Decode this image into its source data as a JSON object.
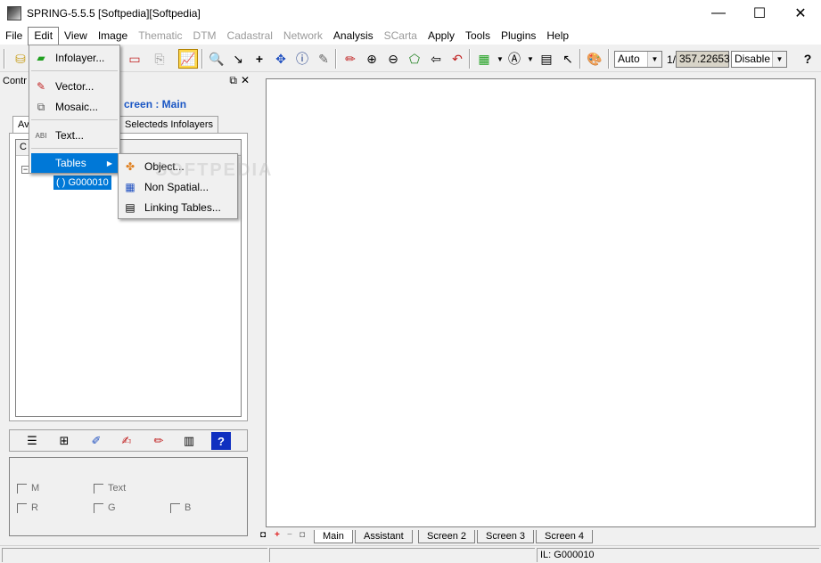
{
  "window": {
    "title": "SPRING-5.5.5 [Softpedia][Softpedia]",
    "minimize": "—",
    "maximize": "☐",
    "close": "✕"
  },
  "menubar": {
    "items": [
      {
        "label": "File",
        "enabled": true
      },
      {
        "label": "Edit",
        "enabled": true
      },
      {
        "label": "View",
        "enabled": true
      },
      {
        "label": "Image",
        "enabled": true
      },
      {
        "label": "Thematic",
        "enabled": false
      },
      {
        "label": "DTM",
        "enabled": false
      },
      {
        "label": "Cadastral",
        "enabled": false
      },
      {
        "label": "Network",
        "enabled": false
      },
      {
        "label": "Analysis",
        "enabled": true
      },
      {
        "label": "SCarta",
        "enabled": false
      },
      {
        "label": "Apply",
        "enabled": true
      },
      {
        "label": "Tools",
        "enabled": true
      },
      {
        "label": "Plugins",
        "enabled": true
      },
      {
        "label": "Help",
        "enabled": true
      }
    ]
  },
  "toolbar": {
    "auto_select": "Auto",
    "scale_prefix": "1/",
    "scale_value": "357.22653",
    "disable_select": "Disable"
  },
  "edit_menu": {
    "items": [
      {
        "label": "Infolayer...",
        "icon": "infolayer-icon"
      },
      {
        "label": "Vector...",
        "icon": "vector-icon"
      },
      {
        "label": "Mosaic...",
        "icon": "mosaic-icon"
      },
      {
        "label": "Text...",
        "icon": "text-icon"
      },
      {
        "label": "Tables",
        "icon": ""
      }
    ]
  },
  "tables_menu": {
    "items": [
      {
        "label": "Object...",
        "icon": "object-icon"
      },
      {
        "label": "Non Spatial...",
        "icon": "grid-icon"
      },
      {
        "label": "Linking Tables...",
        "icon": "table-icon"
      }
    ]
  },
  "control_panel": {
    "title": "Contr",
    "screen_label": "creen : Main",
    "tabs": [
      "Av",
      "Selecteds Infolayers"
    ],
    "tree_header": "C",
    "tree_node": "( ) G000010",
    "checks": [
      {
        "label": "M"
      },
      {
        "label": "Text"
      },
      {
        "label": "R"
      },
      {
        "label": "G"
      },
      {
        "label": "B"
      }
    ]
  },
  "screen_tabs": [
    "Main",
    "Assistant",
    "Screen 2",
    "Screen 3",
    "Screen 4"
  ],
  "statusbar": {
    "info": "IL: G000010"
  },
  "watermark": "SOFTPEDIA"
}
